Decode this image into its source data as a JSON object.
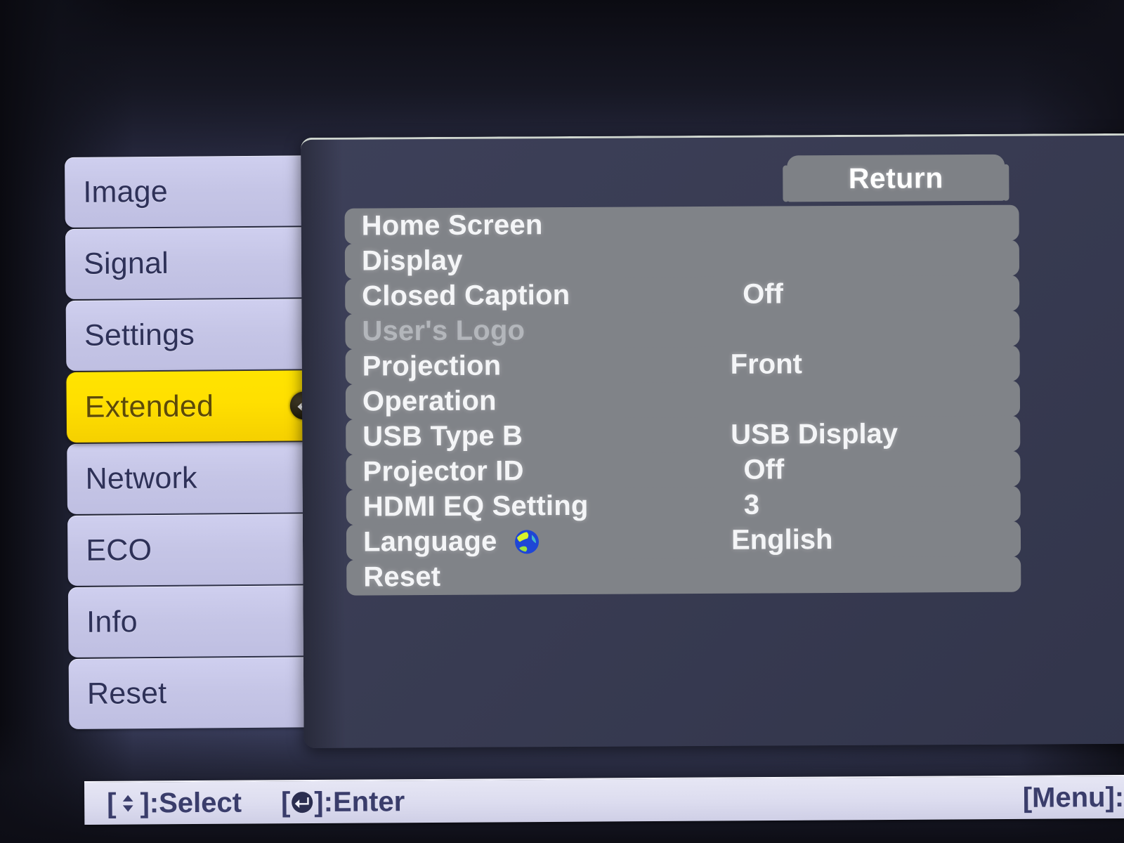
{
  "sidebar": {
    "items": [
      {
        "label": "Image",
        "selected": false
      },
      {
        "label": "Signal",
        "selected": false
      },
      {
        "label": "Settings",
        "selected": false
      },
      {
        "label": "Extended",
        "selected": true
      },
      {
        "label": "Network",
        "selected": false
      },
      {
        "label": "ECO",
        "selected": false
      },
      {
        "label": "Info",
        "selected": false
      },
      {
        "label": "Reset",
        "selected": false
      }
    ],
    "selected_enter_icon": "enter-return-icon"
  },
  "panel": {
    "return_label": "Return",
    "rows": [
      {
        "label": "Home Screen",
        "value": "",
        "dim": false,
        "icon": ""
      },
      {
        "label": "Display",
        "value": "",
        "dim": false,
        "icon": ""
      },
      {
        "label": "Closed Caption",
        "value": "Off",
        "dim": false,
        "icon": ""
      },
      {
        "label": "User's Logo",
        "value": "",
        "dim": true,
        "icon": ""
      },
      {
        "label": "Projection",
        "value": "Front",
        "dim": false,
        "icon": ""
      },
      {
        "label": "Operation",
        "value": "",
        "dim": false,
        "icon": ""
      },
      {
        "label": "USB Type B",
        "value": "USB Display",
        "dim": false,
        "icon": ""
      },
      {
        "label": "Projector ID",
        "value": "Off",
        "dim": false,
        "icon": ""
      },
      {
        "label": "HDMI EQ Setting",
        "value": "3",
        "dim": false,
        "icon": ""
      },
      {
        "label": "Language",
        "value": "English",
        "dim": false,
        "icon": "globe-icon"
      },
      {
        "label": "Reset",
        "value": "",
        "dim": false,
        "icon": ""
      }
    ]
  },
  "status_bar": {
    "select_brackets_open": "[",
    "select_brackets_close": "]:Select",
    "enter_brackets_open": "[",
    "enter_brackets_close": "]:Enter",
    "exit_hint": "[Menu]:Exi"
  },
  "colors": {
    "accent_selected": "#ffe400",
    "sidebar_tab": "#c5c5e6",
    "panel_row_gray": "#808388",
    "window_navy": "#393c53",
    "status_bar": "#dcdcef",
    "text_light": "#f4f5f7",
    "text_dim": "#b3b6bb",
    "text_navy": "#3a3d6b"
  }
}
